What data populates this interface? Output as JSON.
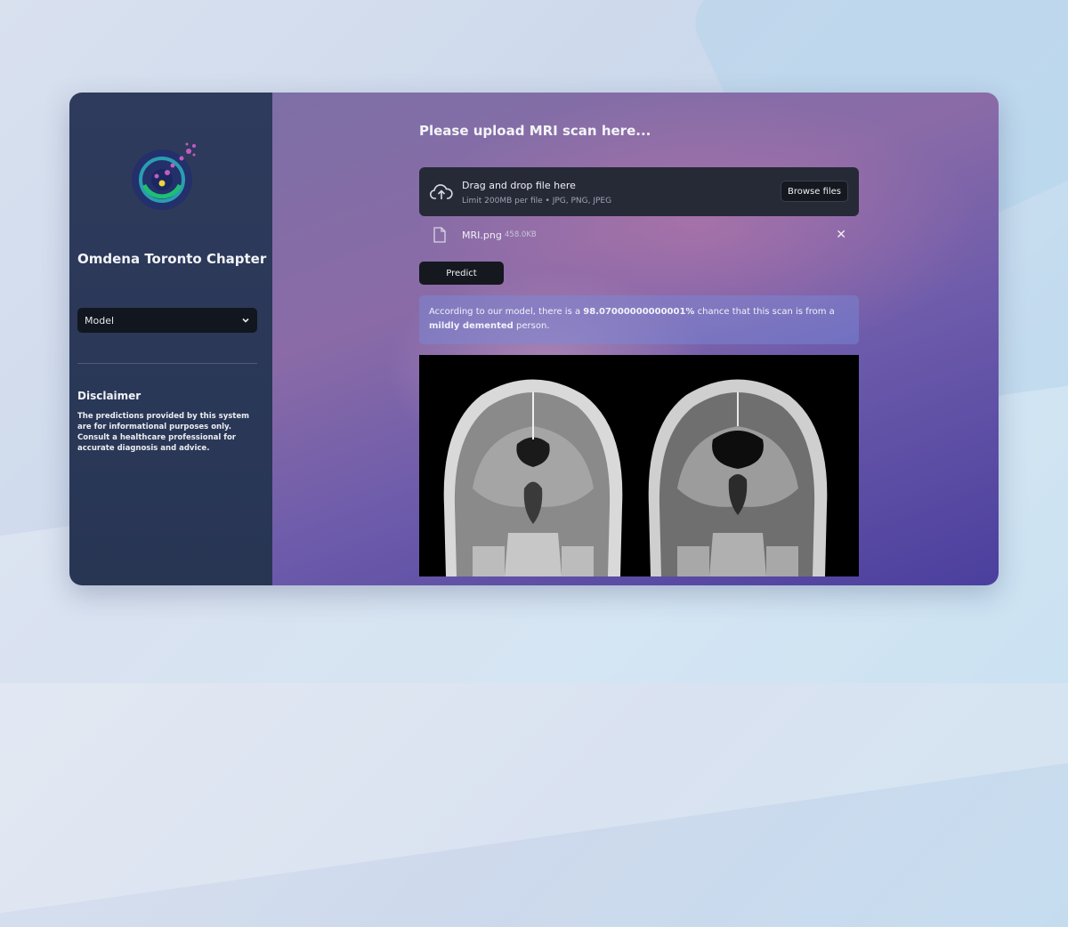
{
  "sidebar": {
    "title": "Omdena Toronto Chapter",
    "model_select": {
      "value": "Model"
    },
    "disclaimer": {
      "title": "Disclaimer",
      "text": "The predictions provided by this system are for informational purposes only. Consult a healthcare professional for accurate diagnosis and advice."
    }
  },
  "main": {
    "heading": "Please upload MRI scan here...",
    "uploader": {
      "title": "Drag and drop file here",
      "subtitle": "Limit 200MB per file • JPG, PNG, JPEG",
      "browse_label": "Browse files"
    },
    "file": {
      "name": "MRI.png",
      "size": "458.0KB",
      "close": "✕"
    },
    "predict_label": "Predict",
    "result": {
      "prefix": "According to our model, there is a ",
      "percent": "98.07000000000001%",
      "middle": " chance that this scan is from a ",
      "class_label": "mildly demented",
      "suffix": " person."
    }
  },
  "icons": [
    "logo-icon",
    "chevron-down-icon",
    "cloud-upload-icon",
    "file-icon",
    "close-icon"
  ],
  "colors": {
    "sidebar_bg": "#2f3b5c",
    "button_bg": "#15181f",
    "dropzone_bg": "#262a37"
  }
}
